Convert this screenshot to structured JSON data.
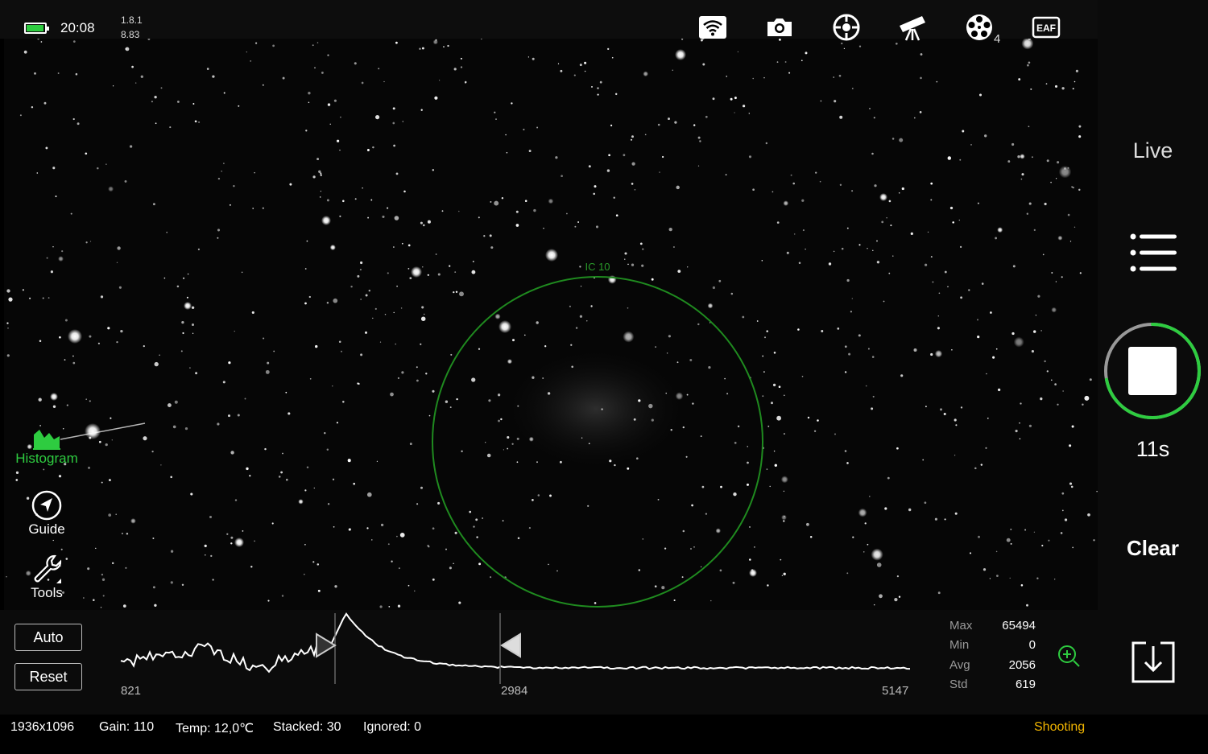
{
  "status": {
    "time": "20:08",
    "version_top": "1.8.1",
    "version_bottom": "8.83",
    "battery_level": 0.85,
    "battery_color": "#2ecc40"
  },
  "toolbar": {
    "icons": [
      "wifi-icon",
      "camera-icon",
      "target-icon",
      "telescope-icon",
      "filter-wheel-icon",
      "eaf-icon",
      "sd-card-icon",
      "info-icon"
    ],
    "filter_wheel_badge": "4",
    "eaf_label": "EAF"
  },
  "sky": {
    "object_label": "IC 10",
    "circle_color": "#1f8a1f"
  },
  "left_tools": {
    "histogram": "Histogram",
    "guide": "Guide",
    "tools": "Tools",
    "active_color": "#2ecc40"
  },
  "right_panel": {
    "live": "Live",
    "countdown": "11s",
    "clear": "Clear",
    "progress_fraction": 0.72,
    "progress_color": "#2ecc40"
  },
  "histogram": {
    "auto": "Auto",
    "reset": "Reset",
    "min_label": "821",
    "mid_label": "2984",
    "max_label": "5147",
    "stats": [
      {
        "key": "Max",
        "value": "65494"
      },
      {
        "key": "Min",
        "value": "0"
      },
      {
        "key": "Avg",
        "value": "2056"
      },
      {
        "key": "Std",
        "value": "619"
      }
    ]
  },
  "statusbar": {
    "resolution": "1936x1096",
    "gain": "Gain: 110",
    "temp": "Temp: 12,0℃",
    "stacked": "Stacked: 30",
    "ignored": "Ignored: 0",
    "state": "Shooting"
  }
}
